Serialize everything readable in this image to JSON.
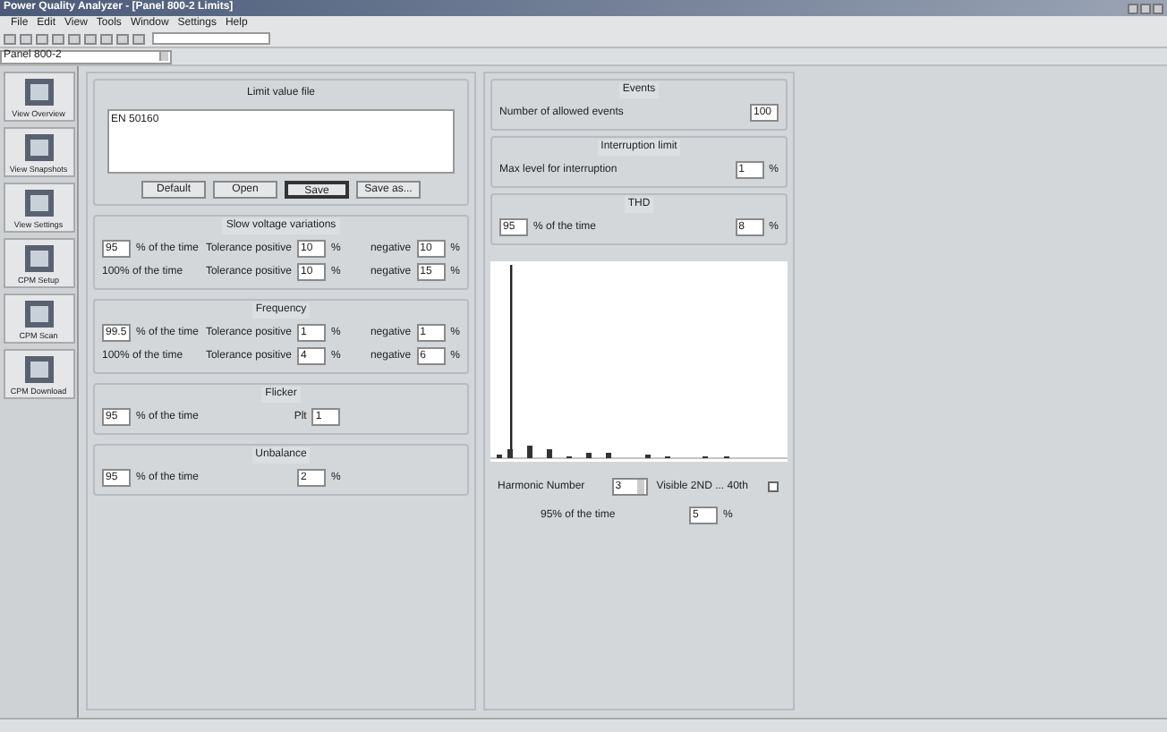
{
  "window": {
    "title": "Power Quality Analyzer - [Panel 800-2 Limits]"
  },
  "menu": [
    "File",
    "Edit",
    "View",
    "Tools",
    "Window",
    "Settings",
    "Help"
  ],
  "panel_select": {
    "value": "Panel 800-2"
  },
  "sidebar": {
    "items": [
      {
        "label": "View Overview"
      },
      {
        "label": "View Snapshots"
      },
      {
        "label": "View Settings"
      },
      {
        "label": "CPM Setup"
      },
      {
        "label": "CPM Scan"
      },
      {
        "label": "CPM Download"
      }
    ]
  },
  "limit_file": {
    "title": "Limit value file",
    "text": "EN 50160",
    "buttons": [
      {
        "label": "Default",
        "focused": false
      },
      {
        "label": "Open",
        "focused": false
      },
      {
        "label": "Save",
        "focused": true
      },
      {
        "label": "Save as...",
        "focused": false
      }
    ]
  },
  "left_groups": [
    {
      "title": "Slow voltage variations",
      "rows": [
        [
          [
            {
              "kind": "field",
              "value": "95"
            },
            {
              "kind": "text",
              "text": "% of the time"
            }
          ],
          [
            {
              "kind": "text",
              "text": "Tolerance positive"
            },
            {
              "kind": "field",
              "value": "10"
            },
            {
              "kind": "text",
              "text": "%"
            }
          ],
          [
            {
              "kind": "text",
              "text": "negative"
            },
            {
              "kind": "field",
              "value": "10"
            },
            {
              "kind": "text",
              "text": "%"
            }
          ]
        ],
        [
          [
            {
              "kind": "text",
              "text": "100% of the time"
            }
          ],
          [
            {
              "kind": "text",
              "text": "Tolerance positive"
            },
            {
              "kind": "field",
              "value": "10"
            },
            {
              "kind": "text",
              "text": "%"
            }
          ],
          [
            {
              "kind": "text",
              "text": "negative"
            },
            {
              "kind": "field",
              "value": "15"
            },
            {
              "kind": "text",
              "text": "%"
            }
          ]
        ]
      ]
    },
    {
      "title": "Frequency",
      "rows": [
        [
          [
            {
              "kind": "field",
              "value": "99.5"
            },
            {
              "kind": "text",
              "text": "% of the time"
            }
          ],
          [
            {
              "kind": "text",
              "text": "Tolerance positive"
            },
            {
              "kind": "field",
              "value": "1"
            },
            {
              "kind": "text",
              "text": "%"
            }
          ],
          [
            {
              "kind": "text",
              "text": "negative"
            },
            {
              "kind": "field",
              "value": "1"
            },
            {
              "kind": "text",
              "text": "%"
            }
          ]
        ],
        [
          [
            {
              "kind": "text",
              "text": "100% of the time"
            }
          ],
          [
            {
              "kind": "text",
              "text": "Tolerance positive"
            },
            {
              "kind": "field",
              "value": "4"
            },
            {
              "kind": "text",
              "text": "%"
            }
          ],
          [
            {
              "kind": "text",
              "text": "negative"
            },
            {
              "kind": "field",
              "value": "6"
            },
            {
              "kind": "text",
              "text": "%"
            }
          ]
        ]
      ]
    },
    {
      "title": "Flicker",
      "rows": [
        [
          [
            {
              "kind": "field",
              "value": "95"
            },
            {
              "kind": "text",
              "text": "% of the time"
            }
          ],
          [
            {
              "kind": "text",
              "text": "Plt"
            },
            {
              "kind": "field",
              "value": "1"
            }
          ]
        ]
      ]
    },
    {
      "title": "Unbalance",
      "rows": [
        [
          [
            {
              "kind": "field",
              "value": "95"
            },
            {
              "kind": "text",
              "text": "% of the time"
            }
          ],
          [
            {
              "kind": "field",
              "value": "2"
            },
            {
              "kind": "text",
              "text": "%"
            }
          ]
        ]
      ]
    }
  ],
  "right_groups": [
    {
      "title": "Events",
      "rows": [
        [
          [
            {
              "kind": "text",
              "text": "Number of allowed events"
            }
          ],
          [
            {
              "kind": "field",
              "value": "100"
            }
          ]
        ]
      ]
    },
    {
      "title": "Interruption limit",
      "rows": [
        [
          [
            {
              "kind": "text",
              "text": "Max level for interruption"
            }
          ],
          [
            {
              "kind": "field",
              "value": "1"
            },
            {
              "kind": "text",
              "text": "%"
            }
          ]
        ]
      ]
    },
    {
      "title": "THD",
      "rows": [
        [
          [
            {
              "kind": "field",
              "value": "95"
            },
            {
              "kind": "text",
              "text": "% of the time"
            }
          ],
          [
            {
              "kind": "field",
              "value": "8"
            },
            {
              "kind": "text",
              "text": "%"
            }
          ]
        ]
      ]
    }
  ],
  "harmonics": {
    "number_label": "Harmonic Number",
    "number": "3",
    "range": "Visible 2ND ... 40th",
    "checked": false,
    "time_label": "95% of the time",
    "value": "5",
    "unit": "%"
  }
}
